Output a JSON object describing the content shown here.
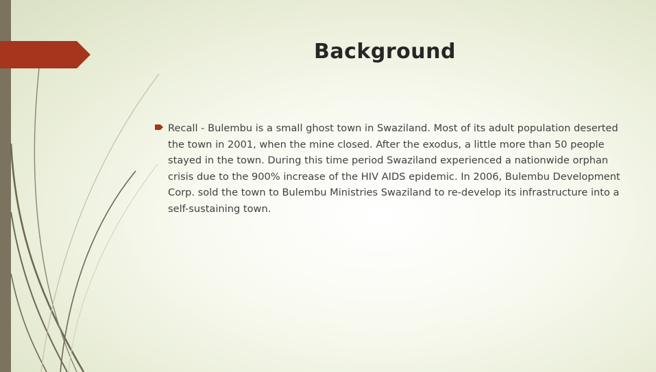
{
  "slide": {
    "title": "Background",
    "bullets": [
      {
        "text": "Recall - Bulembu is a small ghost town in Swaziland.  Most of its adult population deserted the town in 2001, when the mine closed.  After the exodus, a little more than 50 people stayed in the town.  During this time period Swaziland experienced a nationwide orphan crisis due to the 900% increase of the HIV AIDS epidemic.  In 2006, Bulembu Development Corp. sold the town to Bulembu Ministries Swaziland to re-develop its infrastructure into a self-sustaining town."
      }
    ]
  },
  "colors": {
    "accent": "#a5351c",
    "side_bar": "#7b735d",
    "curve": "#6e6853",
    "title_text": "#262626",
    "body_text": "#404040"
  },
  "icons": {
    "bullet": "arrow-bullet-icon",
    "title_tab": "arrow-tab-icon"
  }
}
